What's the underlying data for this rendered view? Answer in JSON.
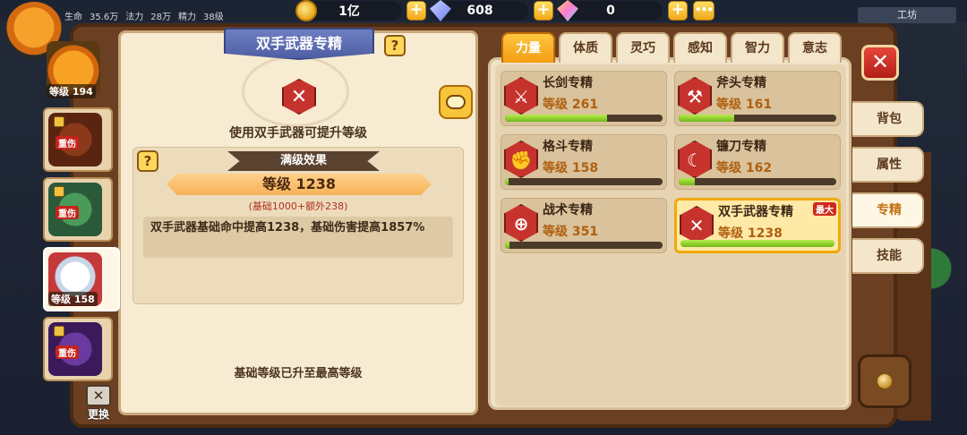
{
  "top_stats": [
    "生命",
    "35.6万",
    "法力",
    "28万",
    "精力",
    "38级"
  ],
  "chest_label": "工坊",
  "currency": {
    "gold": {
      "value": "1亿",
      "icon": "gold-coin-icon"
    },
    "gem": {
      "value": "608",
      "icon": "diamond-icon"
    },
    "rainbow_gem": {
      "value": "0",
      "icon": "rainbow-diamond-icon"
    },
    "plus": "+",
    "more": "•••"
  },
  "detail": {
    "title": "双手武器专精",
    "help": "?",
    "description": "使用双手武器可提升等级",
    "max_effect_label": "满级效果",
    "level_text": "等级 1238",
    "base_extra": "(基础1000+额外238)",
    "effect_text": "双手武器基础命中提高1238，基础伤害提高1857%",
    "max_level_note": "基础等级已升至最高等级"
  },
  "characters": [
    {
      "level": "等级 194",
      "tag": ""
    },
    {
      "level": "",
      "tag": "重伤"
    },
    {
      "level": "",
      "tag": "重伤"
    },
    {
      "level": "等级 158",
      "tag": ""
    },
    {
      "level": "",
      "tag": "重伤"
    }
  ],
  "swap_label": "更换",
  "tabs": [
    "力量",
    "体质",
    "灵巧",
    "感知",
    "智力",
    "意志"
  ],
  "active_tab": "力量",
  "skills": [
    {
      "name": "长剑专精",
      "level": "等级 261",
      "progress": 0.65,
      "icon": "sword-icon"
    },
    {
      "name": "斧头专精",
      "level": "等级 161",
      "progress": 0.35,
      "icon": "axe-icon"
    },
    {
      "name": "格斗专精",
      "level": "等级 158",
      "progress": 0.02,
      "icon": "fist-icon"
    },
    {
      "name": "镰刀专精",
      "level": "等级 162",
      "progress": 0.1,
      "icon": "scythe-icon"
    },
    {
      "name": "战术专精",
      "level": "等级 351",
      "progress": 0.03,
      "icon": "tactics-icon"
    },
    {
      "name": "双手武器专精",
      "level": "等级 1238",
      "progress": 1.0,
      "icon": "crossed-swords-icon",
      "badge": "最大"
    }
  ],
  "side_tabs": [
    "背包",
    "属性",
    "专精",
    "技能"
  ],
  "active_side_tab": "专精",
  "colors": {
    "accent": "#f39d14",
    "progress": "#6fb81a",
    "danger": "#c4241c"
  }
}
